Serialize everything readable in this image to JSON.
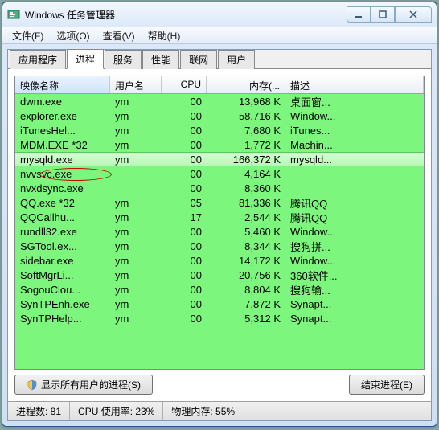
{
  "window": {
    "title": "Windows 任务管理器"
  },
  "menu": {
    "file": "文件(F)",
    "options": "选项(O)",
    "view": "查看(V)",
    "help": "帮助(H)"
  },
  "tabs": {
    "apps": "应用程序",
    "processes": "进程",
    "services": "服务",
    "performance": "性能",
    "network": "联网",
    "users": "用户"
  },
  "columns": {
    "image": "映像名称",
    "user": "用户名",
    "cpu": "CPU",
    "mem": "内存(...",
    "desc": "描述"
  },
  "rows": [
    {
      "image": "dwm.exe",
      "user": "ym",
      "cpu": "00",
      "mem": "13,968 K",
      "desc": "桌面窗..."
    },
    {
      "image": "explorer.exe",
      "user": "ym",
      "cpu": "00",
      "mem": "58,716 K",
      "desc": "Window..."
    },
    {
      "image": "iTunesHel...",
      "user": "ym",
      "cpu": "00",
      "mem": "7,680 K",
      "desc": "iTunes..."
    },
    {
      "image": "MDM.EXE *32",
      "user": "ym",
      "cpu": "00",
      "mem": "1,772 K",
      "desc": "Machin..."
    },
    {
      "image": "mysqld.exe",
      "user": "ym",
      "cpu": "00",
      "mem": "166,372 K",
      "desc": "mysqld...",
      "hl": true,
      "circ": true
    },
    {
      "image": "nvvsvc.exe",
      "user": "",
      "cpu": "00",
      "mem": "4,164 K",
      "desc": ""
    },
    {
      "image": "nvxdsync.exe",
      "user": "",
      "cpu": "00",
      "mem": "8,360 K",
      "desc": ""
    },
    {
      "image": "QQ.exe *32",
      "user": "ym",
      "cpu": "05",
      "mem": "81,336 K",
      "desc": "腾讯QQ"
    },
    {
      "image": "QQCallhu...",
      "user": "ym",
      "cpu": "17",
      "mem": "2,544 K",
      "desc": "腾讯QQ"
    },
    {
      "image": "rundll32.exe",
      "user": "ym",
      "cpu": "00",
      "mem": "5,460 K",
      "desc": "Window..."
    },
    {
      "image": "SGTool.ex...",
      "user": "ym",
      "cpu": "00",
      "mem": "8,344 K",
      "desc": "搜狗拼..."
    },
    {
      "image": "sidebar.exe",
      "user": "ym",
      "cpu": "00",
      "mem": "14,172 K",
      "desc": "Window..."
    },
    {
      "image": "SoftMgrLi...",
      "user": "ym",
      "cpu": "00",
      "mem": "20,756 K",
      "desc": "360软件..."
    },
    {
      "image": "SogouClou...",
      "user": "ym",
      "cpu": "00",
      "mem": "8,804 K",
      "desc": "搜狗输..."
    },
    {
      "image": "SynTPEnh.exe",
      "user": "ym",
      "cpu": "00",
      "mem": "7,872 K",
      "desc": "Synapt..."
    },
    {
      "image": "SynTPHelp...",
      "user": "ym",
      "cpu": "00",
      "mem": "5,312 K",
      "desc": "Synapt..."
    }
  ],
  "buttons": {
    "showall": "显示所有用户的进程(S)",
    "end": "结束进程(E)"
  },
  "status": {
    "procs": "进程数: 81",
    "cpu": "CPU 使用率: 23%",
    "mem": "物理内存: 55%"
  }
}
